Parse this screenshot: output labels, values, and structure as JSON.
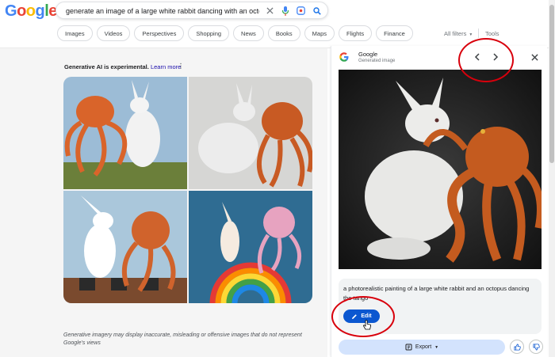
{
  "header": {
    "logo": "Google",
    "query": "generate an image of a large white rabbit dancing with an octopus"
  },
  "filters": {
    "chips": [
      "Images",
      "Videos",
      "Perspectives",
      "Shopping",
      "News",
      "Books",
      "Maps",
      "Flights",
      "Finance"
    ],
    "all_filters": "All filters",
    "tools": "Tools"
  },
  "results": {
    "ai_label": "Generative AI is experimental.",
    "learn_more": "Learn more",
    "disclaimer": "Generative imagery may display inaccurate, misleading or offensive images that do not represent Google's views"
  },
  "panel": {
    "source": "Google",
    "subtitle": "Generated image",
    "description": "a photorealistic painting of a large white rabbit and an octopus dancing the tango",
    "edit_label": "Edit",
    "export_label": "Export"
  },
  "colors": {
    "accent": "#0b57d0",
    "annotation": "#d8000c"
  }
}
